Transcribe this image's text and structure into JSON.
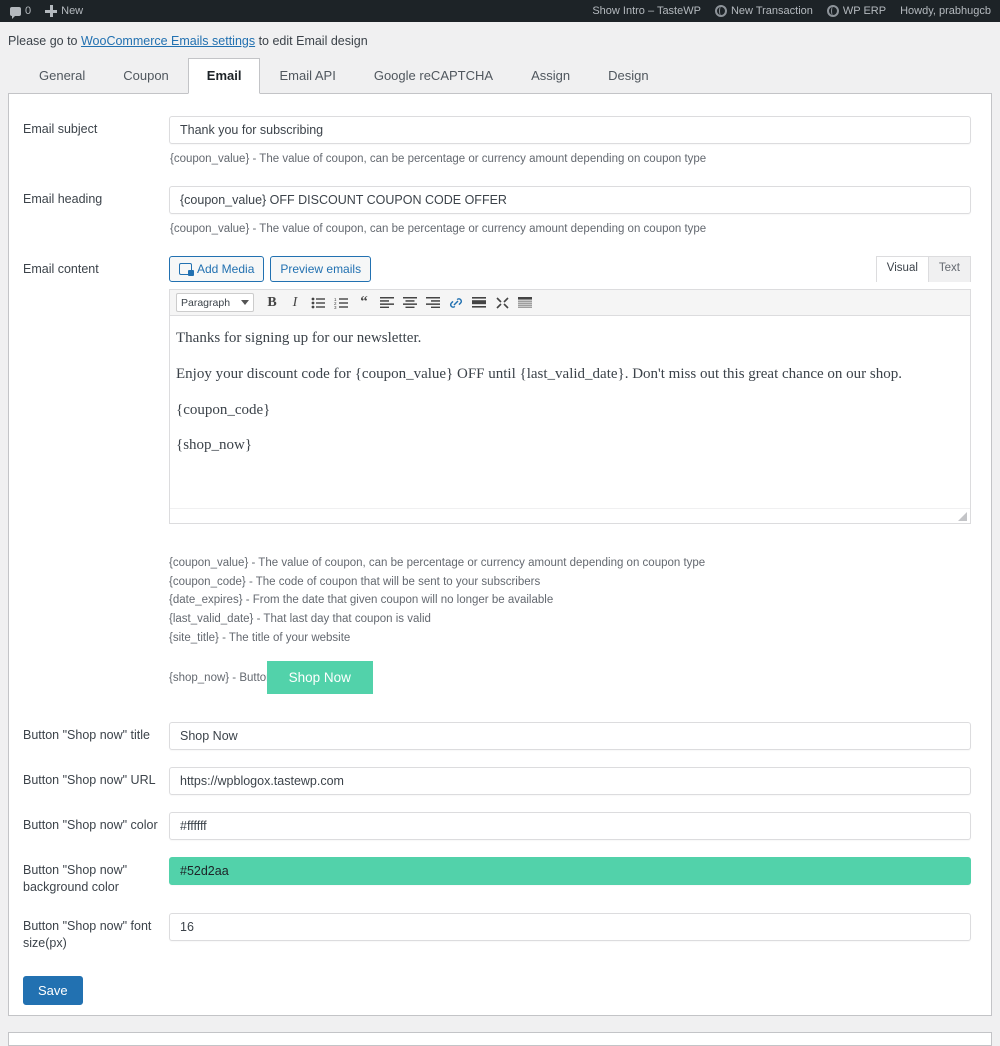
{
  "adminbar": {
    "left_items": [
      {
        "label": "0",
        "icon": "comment-icon",
        "name": "comments-count"
      },
      {
        "label": "New",
        "icon": "plus-icon",
        "name": "new-content"
      }
    ],
    "right_items": [
      {
        "label": "Show Intro – TasteWP",
        "icon": "",
        "name": "show-intro-tastewp"
      },
      {
        "label": "New Transaction",
        "icon": "globe-icon",
        "name": "new-transaction"
      },
      {
        "label": "WP ERP",
        "icon": "globe-icon",
        "name": "wp-erp"
      },
      {
        "label": "Howdy, prabhugcb",
        "icon": "",
        "name": "howdy-user"
      }
    ]
  },
  "notice": {
    "before": "Please go to ",
    "link": "WooCommerce Emails settings",
    "after": " to edit Email design"
  },
  "tabs": [
    {
      "label": "General",
      "active": false
    },
    {
      "label": "Coupon",
      "active": false
    },
    {
      "label": "Email",
      "active": true
    },
    {
      "label": "Email API",
      "active": false
    },
    {
      "label": "Google reCAPTCHA",
      "active": false
    },
    {
      "label": "Assign",
      "active": false
    },
    {
      "label": "Design",
      "active": false
    }
  ],
  "fields": {
    "email_subject": {
      "label": "Email subject",
      "value": "Thank you for subscribing",
      "hint": "{coupon_value} - The value of coupon, can be percentage or currency amount depending on coupon type"
    },
    "email_heading": {
      "label": "Email heading",
      "value": "{coupon_value} OFF DISCOUNT COUPON CODE OFFER",
      "hint": "{coupon_value} - The value of coupon, can be percentage or currency amount depending on coupon type"
    },
    "email_content": {
      "label": "Email content"
    },
    "button_title": {
      "label": "Button \"Shop now\" title",
      "value": "Shop Now"
    },
    "button_url": {
      "label": "Button \"Shop now\" URL",
      "value": "https://wpblogox.tastewp.com"
    },
    "button_color": {
      "label": "Button \"Shop now\" color",
      "value": "#ffffff"
    },
    "button_bg_color": {
      "label": "Button \"Shop now\" background color",
      "value": "#52d2aa"
    },
    "button_font_size": {
      "label": "Button \"Shop now\" font size(px)",
      "value": "16"
    }
  },
  "editor": {
    "add_media_label": "Add Media",
    "preview_emails_label": "Preview emails",
    "visual_tab": "Visual",
    "text_tab": "Text",
    "format_select": "Paragraph",
    "toolbar_icons": [
      "bold-icon",
      "italic-icon",
      "bulleted-list-icon",
      "numbered-list-icon",
      "blockquote-icon",
      "align-left-icon",
      "align-center-icon",
      "align-right-icon",
      "link-icon",
      "read-more-icon",
      "fullscreen-icon",
      "toolbar-toggle-icon"
    ],
    "content_paragraphs": [
      "Thanks for signing up for our newsletter.",
      "Enjoy your discount code for {coupon_value} OFF until {last_valid_date}. Don't miss out this great chance on our shop.",
      "{coupon_code}",
      "{shop_now}"
    ]
  },
  "shortcodes": [
    "{coupon_value} - The value of coupon, can be percentage or currency amount depending on coupon type",
    "{coupon_code} - The code of coupon that will be sent to your subscribers",
    "{date_expires} - From the date that given coupon will no longer be available",
    "{last_valid_date} - That last day that coupon is valid",
    "{site_title} - The title of your website"
  ],
  "shopnow": {
    "prefix_label": "{shop_now} - Button",
    "button_label": "Shop Now"
  },
  "save": {
    "label": "Save"
  },
  "colors": {
    "accent_blue": "#2271b1",
    "brand_green": "#52d2aa",
    "adminbar_bg": "#1d2327",
    "page_bg": "#f0f0f1"
  }
}
